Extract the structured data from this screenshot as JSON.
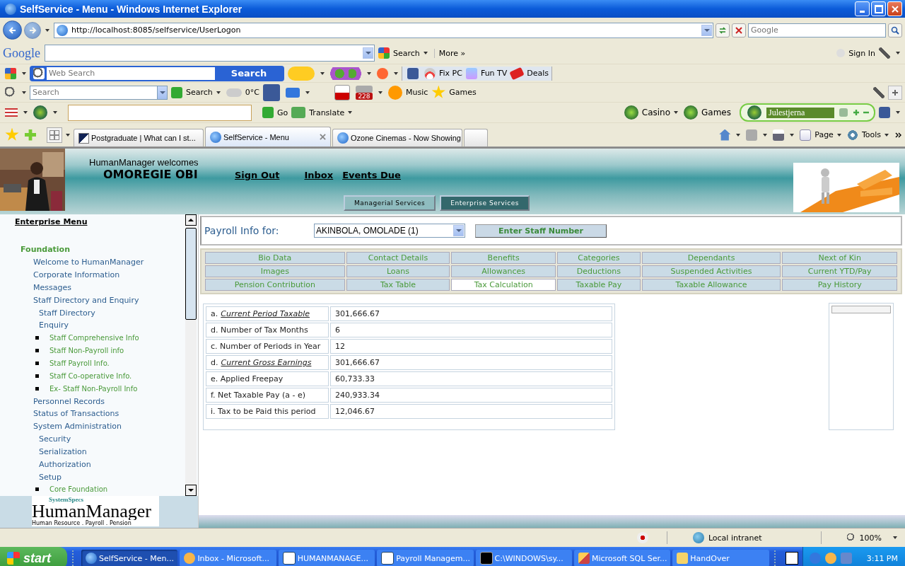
{
  "window": {
    "title": "SelfService - Menu - Windows Internet Explorer"
  },
  "address_bar": {
    "url": "http://localhost:8085/selfservice/UserLogon",
    "search_placeholder": "Google"
  },
  "google_toolbar": {
    "logo": "Google",
    "search_button": "Search",
    "more": "More »",
    "sign_in": "Sign In"
  },
  "web_search_toolbar": {
    "placeholder": "Web Search",
    "button": "Search",
    "links": [
      "Fix PC",
      "Fun TV",
      "Deals"
    ]
  },
  "search_toolbar": {
    "placeholder": "Search",
    "button": "Search",
    "weather": "0°C",
    "badge": "228",
    "links": [
      "Music",
      "Games"
    ]
  },
  "translate_toolbar": {
    "go": "Go",
    "translate": "Translate",
    "links": [
      "Casino",
      "Games"
    ],
    "station": "Julestjerna"
  },
  "tabs": [
    {
      "title": "Postgraduate | What can I st...",
      "selected": false
    },
    {
      "title": "SelfService - Menu",
      "selected": true
    },
    {
      "title": "Ozone Cinemas - Now Showing",
      "selected": false
    }
  ],
  "command_bar": [
    "Page",
    "Tools"
  ],
  "header": {
    "greeting": "HumanManager welcomes",
    "user": "OMOREGIE OBI",
    "links": [
      "Sign Out",
      "Inbox",
      "Events Due"
    ],
    "service_tabs": [
      {
        "label": "Managerial Services",
        "selected": false
      },
      {
        "label": "Enterprise Services",
        "selected": true
      }
    ]
  },
  "sidebar": {
    "title": "Enterprise Menu",
    "sections": [
      {
        "label": "Foundation",
        "children": [
          {
            "label": "Welcome to HumanManager"
          },
          {
            "label": "Corporate Information"
          },
          {
            "label": "Messages"
          },
          {
            "label": "Staff Directory and Enquiry",
            "children": [
              {
                "label": "Staff Directory"
              },
              {
                "label": "Enquiry",
                "children": [
                  {
                    "label": "Staff Comprehensive Info"
                  },
                  {
                    "label": "Staff Non-Payroll info"
                  },
                  {
                    "label": "Staff Payroll Info."
                  },
                  {
                    "label": "Staff Co-operative Info."
                  },
                  {
                    "label": "Ex- Staff Non-Payroll Info"
                  }
                ]
              }
            ]
          },
          {
            "label": "Personnel Records"
          },
          {
            "label": "Status of Transactions"
          },
          {
            "label": "System Administration",
            "children": [
              {
                "label": "Security"
              },
              {
                "label": "Serialization"
              },
              {
                "label": "Authorization"
              },
              {
                "label": "Setup",
                "children": [
                  {
                    "label": "Core Foundation"
                  }
                ]
              }
            ]
          }
        ]
      }
    ],
    "logo": {
      "brand": "SystemSpecs",
      "name": "HumanManager",
      "tagline": "Human Resource . Payroll . Pension"
    }
  },
  "payroll": {
    "label": "Payroll Info for:",
    "employee": "AKINBOLA, OMOLADE (1)",
    "button": "Enter Staff Number"
  },
  "info_tabs": [
    {
      "label": "Bio Data",
      "selected": false
    },
    {
      "label": "Contact Details",
      "selected": false
    },
    {
      "label": "Benefits",
      "selected": false
    },
    {
      "label": "Categories",
      "selected": false
    },
    {
      "label": "Dependants",
      "selected": false
    },
    {
      "label": "Next of Kin",
      "selected": false
    },
    {
      "label": "Images",
      "selected": false
    },
    {
      "label": "Loans",
      "selected": false
    },
    {
      "label": "Allowances",
      "selected": false
    },
    {
      "label": "Deductions",
      "selected": false
    },
    {
      "label": "Suspended Activities",
      "selected": false
    },
    {
      "label": "Current YTD/Pay",
      "selected": false
    },
    {
      "label": "Pension Contribution",
      "selected": false
    },
    {
      "label": "Tax Table",
      "selected": false
    },
    {
      "label": "Tax Calculation",
      "selected": true
    },
    {
      "label": "Taxable Pay",
      "selected": false
    },
    {
      "label": "Taxable Allowance",
      "selected": false
    },
    {
      "label": "Pay History",
      "selected": false
    }
  ],
  "tax_rows": [
    {
      "prefix": "a.",
      "label": "Current Period Taxable",
      "kind": "link",
      "value": "301,666.67"
    },
    {
      "prefix": "d.",
      "label": "Number of Tax Months",
      "kind": "text",
      "value": "6"
    },
    {
      "prefix": "c.",
      "label": "Number of Periods in Year",
      "kind": "text",
      "value": "12"
    },
    {
      "prefix": "d.",
      "label": "Current Gross Earnings",
      "kind": "link",
      "value": "301,666.67"
    },
    {
      "prefix": "e.",
      "label": "Applied Freepay",
      "kind": "text",
      "value": "60,733.33"
    },
    {
      "prefix": "f.",
      "label": "Net Taxable Pay (a - e)",
      "kind": "text",
      "value": "240,933.34"
    },
    {
      "prefix": "i.",
      "label": "Tax to be Paid this period",
      "kind": "text",
      "value": "12,046.67"
    }
  ],
  "status_bar": {
    "zone": "Local intranet",
    "zoom": "100%"
  },
  "taskbar": {
    "start": "start",
    "tasks": [
      {
        "label": "SelfService - Men...",
        "selected": true
      },
      {
        "label": "Inbox - Microsoft...",
        "selected": false
      },
      {
        "label": "HUMANMANAGE...",
        "selected": false
      },
      {
        "label": "Payroll Managem...",
        "selected": false
      },
      {
        "label": "C:\\WINDOWS\\sy...",
        "selected": false
      },
      {
        "label": "Microsoft SQL Ser...",
        "selected": false
      },
      {
        "label": "HandOver",
        "selected": false
      }
    ],
    "clock": "3:11 PM"
  }
}
